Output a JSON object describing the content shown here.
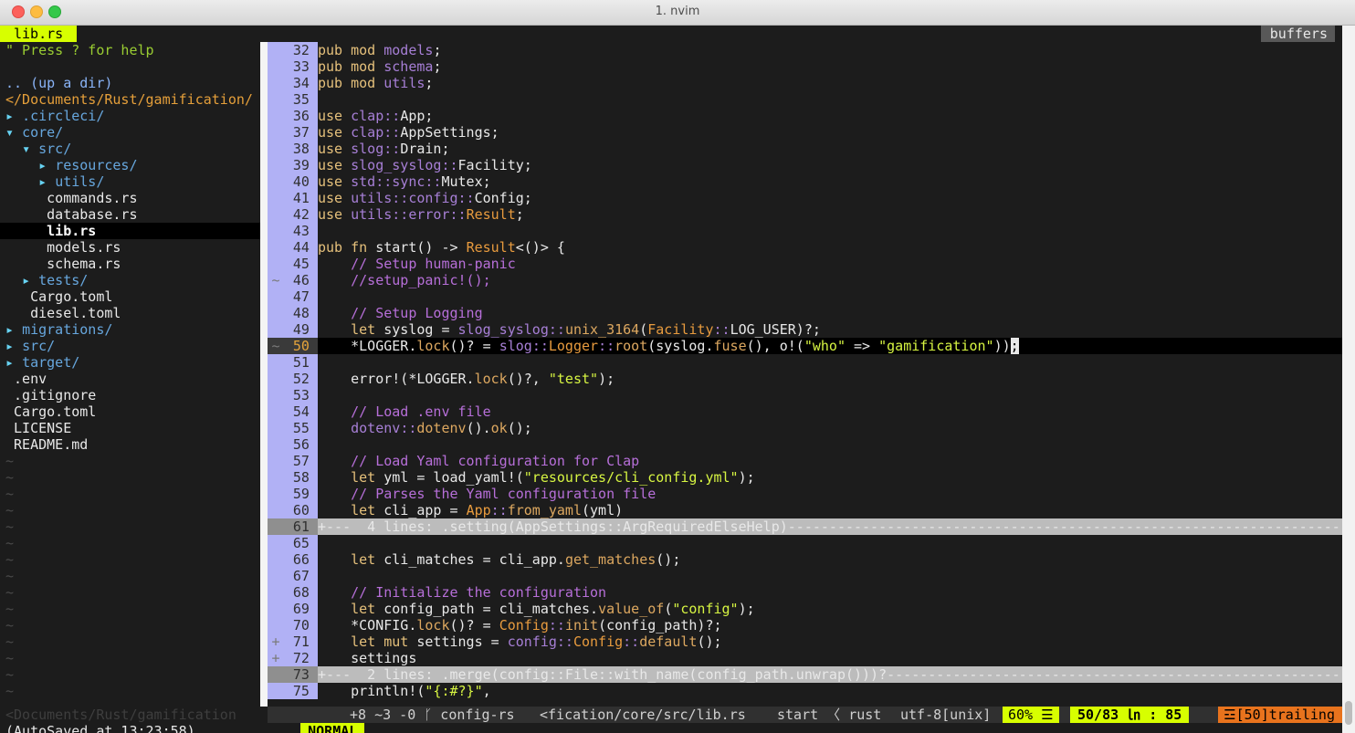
{
  "window": {
    "title": "1. nvim"
  },
  "tree": {
    "tab_label": "lib.rs",
    "help": "\" Press ? for help",
    "up_dir": ".. (up a dir)",
    "cwd": "</Documents/Rust/gamification/",
    "items": [
      {
        "indent": 0,
        "arrow": "▸",
        "name": ".circleci/",
        "kind": "dir"
      },
      {
        "indent": 0,
        "arrow": "▾",
        "name": "core/",
        "kind": "dir"
      },
      {
        "indent": 1,
        "arrow": "▾",
        "name": "src/",
        "kind": "dir"
      },
      {
        "indent": 2,
        "arrow": "▸",
        "name": "resources/",
        "kind": "dir"
      },
      {
        "indent": 2,
        "arrow": "▸",
        "name": "utils/",
        "kind": "dir"
      },
      {
        "indent": 2,
        "arrow": "",
        "name": "commands.rs",
        "kind": "file"
      },
      {
        "indent": 2,
        "arrow": "",
        "name": "database.rs",
        "kind": "file"
      },
      {
        "indent": 2,
        "arrow": "",
        "name": "lib.rs",
        "kind": "selected"
      },
      {
        "indent": 2,
        "arrow": "",
        "name": "models.rs",
        "kind": "file"
      },
      {
        "indent": 2,
        "arrow": "",
        "name": "schema.rs",
        "kind": "file"
      },
      {
        "indent": 1,
        "arrow": "▸",
        "name": "tests/",
        "kind": "dir"
      },
      {
        "indent": 1,
        "arrow": "",
        "name": "Cargo.toml",
        "kind": "file"
      },
      {
        "indent": 1,
        "arrow": "",
        "name": "diesel.toml",
        "kind": "file"
      },
      {
        "indent": 0,
        "arrow": "▸",
        "name": "migrations/",
        "kind": "dir"
      },
      {
        "indent": 0,
        "arrow": "▸",
        "name": "src/",
        "kind": "dir"
      },
      {
        "indent": 0,
        "arrow": "▸",
        "name": "target/",
        "kind": "dir"
      },
      {
        "indent": 0,
        "arrow": "",
        "name": ".env",
        "kind": "file"
      },
      {
        "indent": 0,
        "arrow": "",
        "name": ".gitignore",
        "kind": "file"
      },
      {
        "indent": 0,
        "arrow": "",
        "name": "Cargo.toml",
        "kind": "file"
      },
      {
        "indent": 0,
        "arrow": "",
        "name": "LICENSE",
        "kind": "file"
      },
      {
        "indent": 0,
        "arrow": "",
        "name": "README.md",
        "kind": "file"
      }
    ],
    "tilde_rows": 15,
    "statusline": "<Documents/Rust/gamification"
  },
  "tabline": {
    "buffers_label": "buffers"
  },
  "code": [
    {
      "n": "32",
      "sign": "",
      "style": "",
      "segs": [
        [
          "kw",
          "pub "
        ],
        [
          "kw",
          "mod "
        ],
        [
          "md",
          "models"
        ],
        [
          "pn",
          ";"
        ]
      ]
    },
    {
      "n": "33",
      "sign": "",
      "style": "",
      "segs": [
        [
          "kw",
          "pub "
        ],
        [
          "kw",
          "mod "
        ],
        [
          "md",
          "schema"
        ],
        [
          "pn",
          ";"
        ]
      ]
    },
    {
      "n": "34",
      "sign": "",
      "style": "",
      "segs": [
        [
          "kw",
          "pub "
        ],
        [
          "kw",
          "mod "
        ],
        [
          "md",
          "utils"
        ],
        [
          "pn",
          ";"
        ]
      ]
    },
    {
      "n": "35",
      "sign": "",
      "style": "",
      "segs": []
    },
    {
      "n": "36",
      "sign": "",
      "style": "",
      "segs": [
        [
          "kw",
          "use "
        ],
        [
          "md",
          "clap"
        ],
        [
          "md",
          "::"
        ],
        [
          "tx",
          "App"
        ],
        [
          "pn",
          ";"
        ]
      ]
    },
    {
      "n": "37",
      "sign": "",
      "style": "",
      "segs": [
        [
          "kw",
          "use "
        ],
        [
          "md",
          "clap"
        ],
        [
          "md",
          "::"
        ],
        [
          "tx",
          "AppSettings"
        ],
        [
          "pn",
          ";"
        ]
      ]
    },
    {
      "n": "38",
      "sign": "",
      "style": "",
      "segs": [
        [
          "kw",
          "use "
        ],
        [
          "md",
          "slog"
        ],
        [
          "md",
          "::"
        ],
        [
          "tx",
          "Drain"
        ],
        [
          "pn",
          ";"
        ]
      ]
    },
    {
      "n": "39",
      "sign": "",
      "style": "",
      "segs": [
        [
          "kw",
          "use "
        ],
        [
          "md",
          "slog_syslog"
        ],
        [
          "md",
          "::"
        ],
        [
          "tx",
          "Facility"
        ],
        [
          "pn",
          ";"
        ]
      ]
    },
    {
      "n": "40",
      "sign": "",
      "style": "",
      "segs": [
        [
          "kw",
          "use "
        ],
        [
          "md",
          "std"
        ],
        [
          "md",
          "::"
        ],
        [
          "md",
          "sync"
        ],
        [
          "md",
          "::"
        ],
        [
          "tx",
          "Mutex"
        ],
        [
          "pn",
          ";"
        ]
      ]
    },
    {
      "n": "41",
      "sign": "",
      "style": "",
      "segs": [
        [
          "kw",
          "use "
        ],
        [
          "md",
          "utils"
        ],
        [
          "md",
          "::"
        ],
        [
          "md",
          "config"
        ],
        [
          "md",
          "::"
        ],
        [
          "tx",
          "Config"
        ],
        [
          "pn",
          ";"
        ]
      ]
    },
    {
      "n": "42",
      "sign": "",
      "style": "",
      "segs": [
        [
          "kw",
          "use "
        ],
        [
          "md",
          "utils"
        ],
        [
          "md",
          "::"
        ],
        [
          "md",
          "error"
        ],
        [
          "md",
          "::"
        ],
        [
          "ty",
          "Result"
        ],
        [
          "pn",
          ";"
        ]
      ]
    },
    {
      "n": "43",
      "sign": "",
      "style": "",
      "segs": []
    },
    {
      "n": "44",
      "sign": "",
      "style": "",
      "segs": [
        [
          "kw",
          "pub "
        ],
        [
          "kw",
          "fn "
        ],
        [
          "tx",
          "start() -> "
        ],
        [
          "ty",
          "Result"
        ],
        [
          "tx",
          "<()> {"
        ]
      ]
    },
    {
      "n": "45",
      "sign": "",
      "style": "",
      "segs": [
        [
          "tx",
          "    "
        ],
        [
          "cm",
          "// Setup human-panic"
        ]
      ]
    },
    {
      "n": "46",
      "sign": "~",
      "style": "",
      "segs": [
        [
          "tx",
          "    "
        ],
        [
          "cm",
          "//setup_panic!();"
        ]
      ]
    },
    {
      "n": "47",
      "sign": "",
      "style": "",
      "segs": []
    },
    {
      "n": "48",
      "sign": "",
      "style": "",
      "segs": [
        [
          "tx",
          "    "
        ],
        [
          "cm",
          "// Setup Logging"
        ]
      ]
    },
    {
      "n": "49",
      "sign": "",
      "style": "",
      "segs": [
        [
          "tx",
          "    "
        ],
        [
          "kw",
          "let "
        ],
        [
          "tx",
          "syslog = "
        ],
        [
          "md",
          "slog_syslog"
        ],
        [
          "md",
          "::"
        ],
        [
          "fn",
          "unix_3164"
        ],
        [
          "tx",
          "("
        ],
        [
          "ty",
          "Facility"
        ],
        [
          "md",
          "::"
        ],
        [
          "tx",
          "LOG_USER)?;"
        ]
      ]
    },
    {
      "n": "50",
      "sign": "~",
      "style": "cur",
      "segs": [
        [
          "tx",
          "    *LOGGER."
        ],
        [
          "fn",
          "lock"
        ],
        [
          "tx",
          "()? = "
        ],
        [
          "md",
          "slog"
        ],
        [
          "md",
          "::"
        ],
        [
          "ty",
          "Logger"
        ],
        [
          "md",
          "::"
        ],
        [
          "fn",
          "root"
        ],
        [
          "tx",
          "(syslog."
        ],
        [
          "fn",
          "fuse"
        ],
        [
          "tx",
          "(), o!("
        ],
        [
          "st",
          "\"who\""
        ],
        [
          "tx",
          " => "
        ],
        [
          "st",
          "\"gamification\""
        ],
        [
          "tx",
          "))"
        ],
        [
          "cursor",
          ";"
        ]
      ]
    },
    {
      "n": "51",
      "sign": "",
      "style": "",
      "segs": []
    },
    {
      "n": "52",
      "sign": "",
      "style": "",
      "segs": [
        [
          "tx",
          "    error!(*LOGGER."
        ],
        [
          "fn",
          "lock"
        ],
        [
          "tx",
          "()?, "
        ],
        [
          "st",
          "\"test\""
        ],
        [
          "tx",
          ");"
        ]
      ]
    },
    {
      "n": "53",
      "sign": "",
      "style": "",
      "segs": []
    },
    {
      "n": "54",
      "sign": "",
      "style": "",
      "segs": [
        [
          "tx",
          "    "
        ],
        [
          "cm",
          "// Load .env file"
        ]
      ]
    },
    {
      "n": "55",
      "sign": "",
      "style": "",
      "segs": [
        [
          "tx",
          "    "
        ],
        [
          "md",
          "dotenv"
        ],
        [
          "md",
          "::"
        ],
        [
          "fn",
          "dotenv"
        ],
        [
          "tx",
          "()."
        ],
        [
          "fn",
          "ok"
        ],
        [
          "tx",
          "();"
        ]
      ]
    },
    {
      "n": "56",
      "sign": "",
      "style": "",
      "segs": []
    },
    {
      "n": "57",
      "sign": "",
      "style": "",
      "segs": [
        [
          "tx",
          "    "
        ],
        [
          "cm",
          "// Load Yaml configuration for Clap"
        ]
      ]
    },
    {
      "n": "58",
      "sign": "",
      "style": "",
      "segs": [
        [
          "tx",
          "    "
        ],
        [
          "kw",
          "let "
        ],
        [
          "tx",
          "yml = load_yaml!("
        ],
        [
          "st",
          "\"resources/cli_config.yml\""
        ],
        [
          "tx",
          ");"
        ]
      ]
    },
    {
      "n": "59",
      "sign": "",
      "style": "",
      "segs": [
        [
          "tx",
          "    "
        ],
        [
          "cm",
          "// Parses the Yaml configuration file"
        ]
      ]
    },
    {
      "n": "60",
      "sign": "",
      "style": "",
      "segs": [
        [
          "tx",
          "    "
        ],
        [
          "kw",
          "let "
        ],
        [
          "tx",
          "cli_app = "
        ],
        [
          "ty",
          "App"
        ],
        [
          "md",
          "::"
        ],
        [
          "fn",
          "from_yaml"
        ],
        [
          "tx",
          "(yml)"
        ]
      ]
    },
    {
      "n": "61",
      "sign": "",
      "style": "fold",
      "segs": [
        [
          "tx",
          "+---  4 lines: .setting(AppSettings::ArgRequiredElseHelp)-----------------------------------------------------------------------------------"
        ]
      ]
    },
    {
      "n": "65",
      "sign": "",
      "style": "",
      "segs": []
    },
    {
      "n": "66",
      "sign": "",
      "style": "",
      "segs": [
        [
          "tx",
          "    "
        ],
        [
          "kw",
          "let "
        ],
        [
          "tx",
          "cli_matches = cli_app."
        ],
        [
          "fn",
          "get_matches"
        ],
        [
          "tx",
          "();"
        ]
      ]
    },
    {
      "n": "67",
      "sign": "",
      "style": "",
      "segs": []
    },
    {
      "n": "68",
      "sign": "",
      "style": "",
      "segs": [
        [
          "tx",
          "    "
        ],
        [
          "cm",
          "// Initialize the configuration"
        ]
      ]
    },
    {
      "n": "69",
      "sign": "",
      "style": "",
      "segs": [
        [
          "tx",
          "    "
        ],
        [
          "kw",
          "let "
        ],
        [
          "tx",
          "config_path = cli_matches."
        ],
        [
          "fn",
          "value_of"
        ],
        [
          "tx",
          "("
        ],
        [
          "st",
          "\"config\""
        ],
        [
          "tx",
          ");"
        ]
      ]
    },
    {
      "n": "70",
      "sign": "",
      "style": "",
      "segs": [
        [
          "tx",
          "    *CONFIG."
        ],
        [
          "fn",
          "lock"
        ],
        [
          "tx",
          "()? = "
        ],
        [
          "ty",
          "Config"
        ],
        [
          "md",
          "::"
        ],
        [
          "fn",
          "init"
        ],
        [
          "tx",
          "(config_path)?;"
        ]
      ]
    },
    {
      "n": "71",
      "sign": "+",
      "style": "",
      "segs": [
        [
          "tx",
          "    "
        ],
        [
          "kw",
          "let mut "
        ],
        [
          "tx",
          "settings = "
        ],
        [
          "md",
          "config"
        ],
        [
          "md",
          "::"
        ],
        [
          "ty",
          "Config"
        ],
        [
          "md",
          "::"
        ],
        [
          "fn",
          "default"
        ],
        [
          "tx",
          "();"
        ]
      ]
    },
    {
      "n": "72",
      "sign": "+",
      "style": "",
      "segs": [
        [
          "tx",
          "    settings"
        ]
      ]
    },
    {
      "n": "73",
      "sign": "",
      "style": "fold",
      "segs": [
        [
          "tx",
          "+---  2 lines: .merge(config::File::with_name(config_path.unwrap()))?-------------------------------------------------------------------"
        ]
      ]
    },
    {
      "n": "75",
      "sign": "",
      "style": "",
      "segs": [
        [
          "tx",
          "    println!("
        ],
        [
          "st",
          "\"{:#?}\""
        ],
        [
          "tx",
          ","
        ]
      ]
    }
  ],
  "statusline": {
    "mode": "NORMAL",
    "git": "+8 ~3 -0 ᚴ config-rs",
    "file": "<fication/core/src/lib.rs",
    "func": "start 〈 rust",
    "encoding": "utf-8[unix]",
    "percent": "60% ☰",
    "position": "50/83 ㏑ : 85",
    "trailing": "☲[50]trailing"
  },
  "cmdline": "(AutoSaved at 13:23:58)"
}
